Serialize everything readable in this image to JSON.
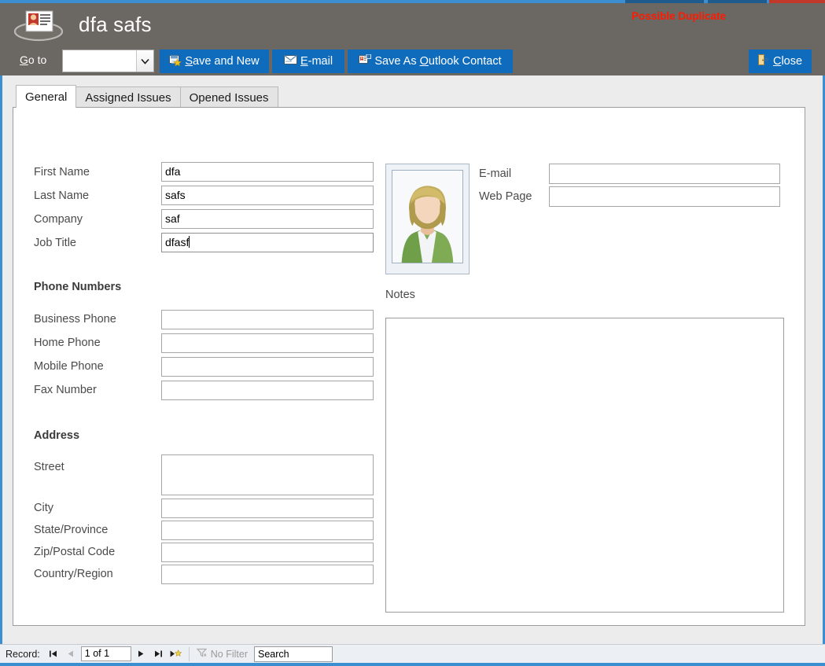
{
  "window": {
    "title": "dfa safs",
    "app_icon": "contact-card-icon",
    "duplicate_warning": "Possible Duplicate",
    "duplicate_warning_color": "#ff1a00",
    "header_bg": "#6b6762",
    "accent_color": "#3b8fd1",
    "button_color": "#0f6cbd"
  },
  "command_bar": {
    "goto_label_pre": "G",
    "goto_label_post": "o to",
    "goto_value": "",
    "goto_placeholder": "",
    "goto_arrow_icon": "chevron-down-icon",
    "buttons": [
      {
        "id": "save-and-new",
        "icon": "save-new-icon",
        "pre": "",
        "accel": "S",
        "post": "ave and New"
      },
      {
        "id": "email",
        "icon": "envelope-icon",
        "pre": "",
        "accel": "E",
        "post": "-mail"
      },
      {
        "id": "save-outlook",
        "icon": "outlook-contact-icon",
        "pre": "Save As ",
        "accel": "O",
        "post": "utlook Contact"
      },
      {
        "id": "close",
        "icon": "close-door-icon",
        "pre": "",
        "accel": "C",
        "post": "lose"
      }
    ]
  },
  "tabs": [
    {
      "label": "General",
      "active": true
    },
    {
      "label": "Assigned Issues",
      "active": false
    },
    {
      "label": "Opened Issues",
      "active": false
    }
  ],
  "form": {
    "identity_fields": [
      {
        "label": "First Name",
        "value": "dfa",
        "focused": false
      },
      {
        "label": "Last Name",
        "value": "safs",
        "focused": false
      },
      {
        "label": "Company",
        "value": "saf",
        "focused": false
      },
      {
        "label": "Job Title",
        "value": "dfasf",
        "focused": true
      }
    ],
    "phone_section_title": "Phone Numbers",
    "phone_fields": [
      {
        "label": "Business Phone",
        "value": ""
      },
      {
        "label": "Home Phone",
        "value": ""
      },
      {
        "label": "Mobile Phone",
        "value": ""
      },
      {
        "label": "Fax Number",
        "value": ""
      }
    ],
    "address_section_title": "Address",
    "address_fields": [
      {
        "label": "Street",
        "value": ""
      },
      {
        "label": "City",
        "value": ""
      },
      {
        "label": "State/Province",
        "value": ""
      },
      {
        "label": "Zip/Postal Code",
        "value": ""
      },
      {
        "label": "Country/Region",
        "value": ""
      }
    ],
    "photo": {
      "name": "contact-photo",
      "alt": "contact portrait placeholder"
    },
    "contact_fields": [
      {
        "label": "E-mail",
        "value": ""
      },
      {
        "label": "Web Page",
        "value": ""
      }
    ],
    "notes_label": "Notes",
    "notes_value": ""
  },
  "statusbar": {
    "record_label": "Record:",
    "first_icon": "first-record-icon",
    "prev_icon": "previous-record-icon",
    "record_position": "1 of 1",
    "next_icon": "next-record-icon",
    "last_icon": "last-record-icon",
    "new_icon": "new-record-icon",
    "filter_icon": "filter-icon",
    "filter_label": "No Filter",
    "search_value": "Search"
  }
}
